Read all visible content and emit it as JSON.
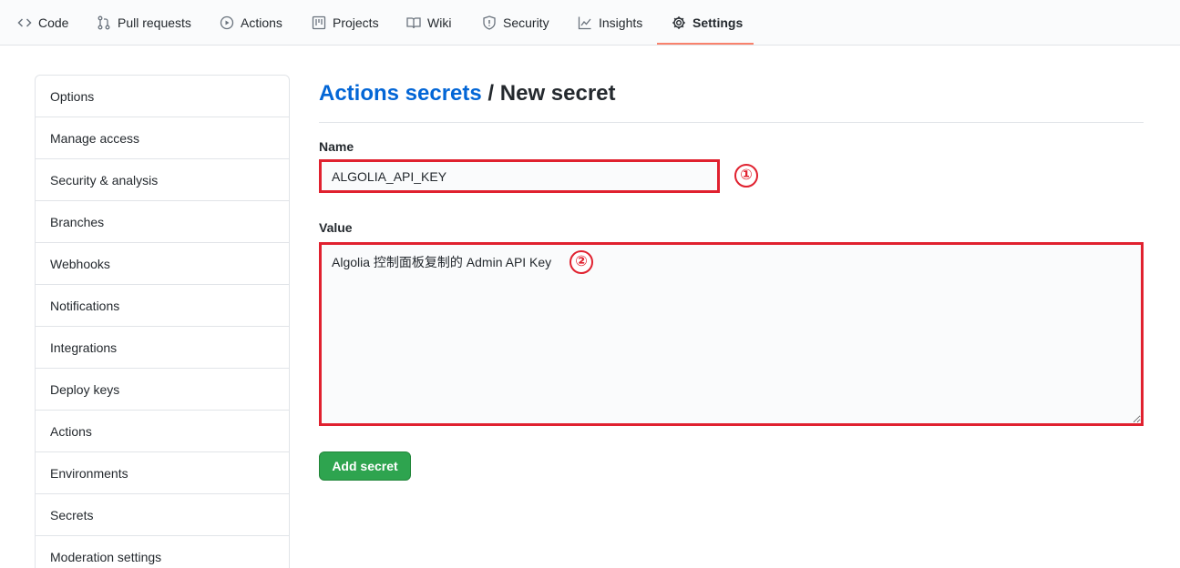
{
  "nav": {
    "tabs": [
      {
        "label": "Code",
        "icon": "code-icon"
      },
      {
        "label": "Pull requests",
        "icon": "pull-request-icon"
      },
      {
        "label": "Actions",
        "icon": "play-icon"
      },
      {
        "label": "Projects",
        "icon": "project-icon"
      },
      {
        "label": "Wiki",
        "icon": "book-icon"
      },
      {
        "label": "Security",
        "icon": "shield-icon"
      },
      {
        "label": "Insights",
        "icon": "graph-icon"
      },
      {
        "label": "Settings",
        "icon": "gear-icon",
        "active": true
      }
    ],
    "active_color": "#f9826c"
  },
  "sidebar": {
    "items": [
      "Options",
      "Manage access",
      "Security & analysis",
      "Branches",
      "Webhooks",
      "Notifications",
      "Integrations",
      "Deploy keys",
      "Actions",
      "Environments",
      "Secrets",
      "Moderation settings"
    ]
  },
  "main": {
    "breadcrumb_link": "Actions secrets",
    "breadcrumb_sep": "/",
    "breadcrumb_current": "New secret",
    "name_label": "Name",
    "name_value": "ALGOLIA_API_KEY",
    "value_label": "Value",
    "value_value": "Algolia 控制面板复制的 Admin API Key",
    "submit_label": "Add secret"
  },
  "annotations": {
    "badge_1": "①",
    "badge_2": "②",
    "highlight_color": "#e0212f"
  },
  "colors": {
    "link": "#0366d6",
    "button": "#2ea44f"
  }
}
